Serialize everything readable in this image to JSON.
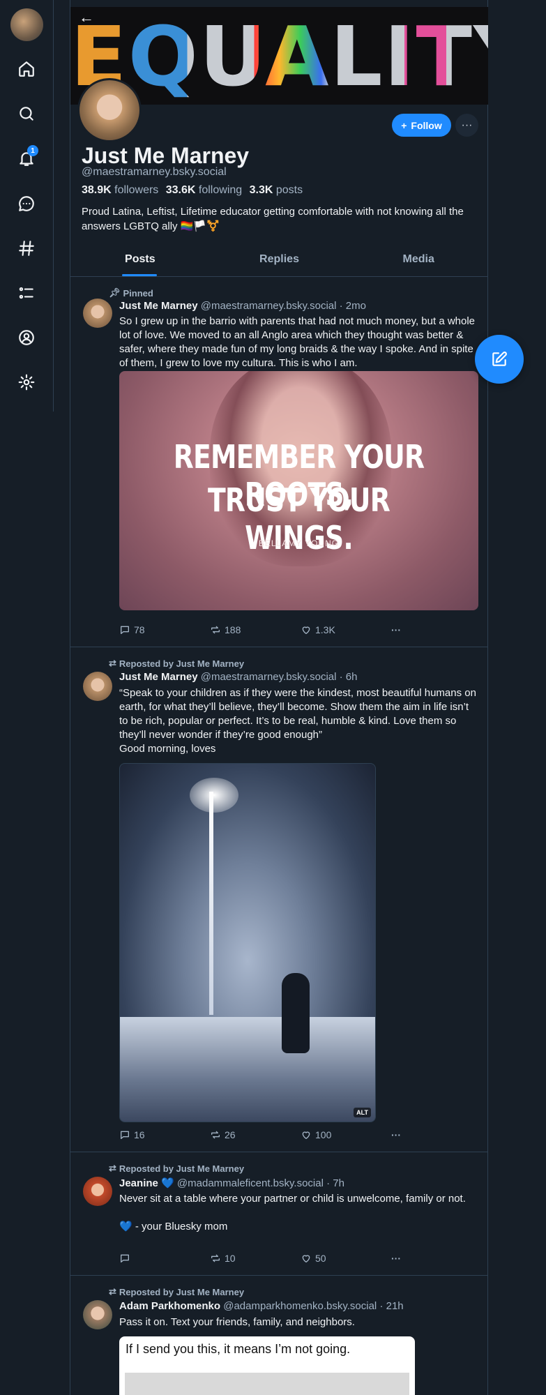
{
  "nav": {
    "avatar_icon": "user-avatar",
    "items": [
      {
        "name": "home",
        "icon": "house-icon"
      },
      {
        "name": "search",
        "icon": "search-icon"
      },
      {
        "name": "notifications",
        "icon": "bell-icon",
        "badge": "1"
      },
      {
        "name": "chat",
        "icon": "chat-bubble-icon"
      },
      {
        "name": "feeds",
        "icon": "hashtag-icon"
      },
      {
        "name": "lists",
        "icon": "list-icon"
      },
      {
        "name": "profile",
        "icon": "user-circle-icon"
      },
      {
        "name": "settings",
        "icon": "gear-icon"
      }
    ]
  },
  "profile": {
    "banner_text": "EQUALITY",
    "display_name": "Just Me Marney",
    "handle": "@maestramarney.bsky.social",
    "followers_count": "38.9K",
    "followers_label": "followers",
    "following_count": "33.6K",
    "following_label": "following",
    "posts_count": "3.3K",
    "posts_label": "posts",
    "bio": "Proud Latina, Leftist, Lifetime educator getting comfortable with not knowing all the answers  LGBTQ ally 🏳️‍🌈🏳️⚧️",
    "follow_label": "Follow",
    "more_label": "···"
  },
  "tabs": [
    "Posts",
    "Replies",
    "Media"
  ],
  "posts": [
    {
      "context": "Pinned",
      "author": "Just Me Marney",
      "handle": "@maestramarney.bsky.social",
      "time": "· 2mo",
      "text": "So I grew up in the barrio with parents that had not much money, but a whole lot of love. We moved to an all Anglo area which they thought was better & safer, where they made fun of my long braids & the way I spoke. And in spite of them, I grew to love my cultura. This is who I am.",
      "image_quote_line1": "REMEMBER YOUR ROOTS,",
      "image_quote_line2": "TRUST YOUR WINGS.",
      "image_author": "BELLAMY YOUNG",
      "replies": "78",
      "reposts": "188",
      "likes": "1.3K"
    },
    {
      "context": "Reposted by Just Me Marney",
      "author": "Just Me Marney",
      "handle": "@maestramarney.bsky.social",
      "time": "· 6h",
      "text": "“Speak to your children as if they were the kindest, most beautiful humans on earth, for what they’ll believe, they’ll become. Show them the aim in life isn’t to be rich, popular or perfect. It’s to be real, humble & kind. Love them so they’ll never wonder if they’re good enough”\nGood morning, loves",
      "alt_label": "ALT",
      "replies": "16",
      "reposts": "26",
      "likes": "100"
    },
    {
      "context": "Reposted by Just Me Marney",
      "author": "Jeanine",
      "verified": "💙",
      "handle": "@madammaleficent.bsky.social",
      "time": "· 7h",
      "text": "Never sit at a table where your partner or child is unwelcome, family or not.\n\n💙 - your Bluesky mom",
      "replies": "",
      "reposts": "10",
      "likes": "50"
    },
    {
      "context": "Reposted by Just Me Marney",
      "author": "Adam Parkhomenko",
      "handle": "@adamparkhomenko.bsky.social",
      "time": "· 21h",
      "text": "Pass it on. Text your friends, family, and neighbors.",
      "image_text": "If I send you this, it means I’m not going."
    }
  ],
  "more_actions_label": "···",
  "colors": {
    "background": "#161e27",
    "accent": "#208bfe",
    "muted_text": "#a3b3c4",
    "border": "#2e4052"
  }
}
